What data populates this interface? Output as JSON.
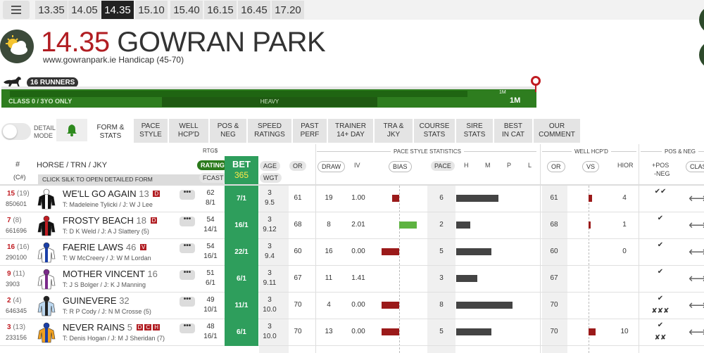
{
  "menu": {
    "icon": "hamburger-icon"
  },
  "times": [
    "13.35",
    "14.05",
    "14.35",
    "15.10",
    "15.40",
    "16.15",
    "16.45",
    "17.20"
  ],
  "active_time": "14.35",
  "race": {
    "time": "14.35",
    "course": "GOWRAN PARK",
    "name": "www.gowranpark.ie Handicap (45-70)",
    "weather_icon": "partly-cloudy-icon"
  },
  "runners_badge": "16 RUNNERS",
  "track": {
    "class_label": "CLASS 0 / 3YO ONLY",
    "going": "HEAVY",
    "distance": "1M",
    "marker": "1M"
  },
  "detail_mode": {
    "label_1": "DETAIL",
    "label_2": "MODE"
  },
  "tabs": [
    {
      "l1": "FORM &",
      "l2": "STATS"
    },
    {
      "l1": "PACE",
      "l2": "STYLE"
    },
    {
      "l1": "WELL",
      "l2": "HCP'D"
    },
    {
      "l1": "POS &",
      "l2": "NEG"
    },
    {
      "l1": "SPEED",
      "l2": "RATINGS"
    },
    {
      "l1": "PAST",
      "l2": "PERF"
    },
    {
      "l1": "TRAINER",
      "l2": "14+ DAY"
    },
    {
      "l1": "TRA &",
      "l2": "JKY"
    },
    {
      "l1": "COURSE",
      "l2": "STATS"
    },
    {
      "l1": "SIRE",
      "l2": "STATS"
    },
    {
      "l1": "BEST",
      "l2": "IN CAT"
    },
    {
      "l1": "OUR",
      "l2": "COMMENT"
    }
  ],
  "header": {
    "num": "#",
    "cnum": "(C#)",
    "horse": "HORSE / TRN / JKY",
    "silk_hint": "CLICK SILK TO OPEN DETAILED FORM",
    "rtgs": "RTG$",
    "rating": "RATING",
    "fcast": "FCAST",
    "bet": "BET",
    "bet_num": "365",
    "age": "AGE",
    "wgt": "WGT",
    "or": "OR",
    "pace_stats": "PACE STYLE STATISTICS",
    "draw": "DRAW",
    "iv": "IV",
    "bias": "BIAS",
    "pace": "PACE",
    "h": "H",
    "m": "M",
    "p": "P",
    "l": "L",
    "well_hcpd": "WELL HCP'D",
    "or2": "OR",
    "vs": "VS",
    "hior": "HIOR",
    "pos_neg": "POS & NEG",
    "pos_neg_col_1": "+POS",
    "pos_neg_col_2": "-NEG",
    "class": "CLASS"
  },
  "runners": [
    {
      "num": "15",
      "cnum": "(19)",
      "form": "850601",
      "name": "WE'LL GO AGAIN",
      "age_days": "13",
      "badges": [
        "D"
      ],
      "tj": "T: Madeleine Tylicki / J: W J Lee",
      "rating": "62",
      "fcast": "8/1",
      "bet": "7/1",
      "age": "3",
      "wgt": "9.5",
      "or": "61",
      "draw": "19",
      "iv": "1.00",
      "bias": -0.2,
      "pace": "6",
      "pace_bar": 0.6,
      "or2": "61",
      "vs": 0.1,
      "hior": "4",
      "pos": "✔✔",
      "neg": ""
    },
    {
      "num": "7",
      "cnum": "(8)",
      "form": "661696",
      "name": "FROSTY BEACH",
      "age_days": "18",
      "badges": [
        "D"
      ],
      "tj": "T: D K Weld / J: A J Slattery (5)",
      "rating": "54",
      "fcast": "14/1",
      "bet": "16/1",
      "age": "3",
      "wgt": "9.12",
      "or": "68",
      "draw": "8",
      "iv": "2.01",
      "bias": 0.5,
      "pace": "2",
      "pace_bar": 0.2,
      "or2": "68",
      "vs": 0.05,
      "hior": "1",
      "pos": "✔",
      "neg": ""
    },
    {
      "num": "16",
      "cnum": "(16)",
      "form": "290100",
      "name": "FAERIE LAWS",
      "age_days": "46",
      "badges": [
        "V"
      ],
      "tj": "T: W McCreery / J: W M Lordan",
      "rating": "54",
      "fcast": "16/1",
      "bet": "22/1",
      "age": "3",
      "wgt": "9.4",
      "or": "60",
      "draw": "16",
      "iv": "0.00",
      "bias": -0.5,
      "pace": "5",
      "pace_bar": 0.5,
      "or2": "60",
      "vs": 0,
      "hior": "0",
      "pos": "✔",
      "neg": ""
    },
    {
      "num": "9",
      "cnum": "(11)",
      "form": "3903",
      "name": "MOTHER VINCENT",
      "age_days": "16",
      "badges": [],
      "tj": "T: J S Bolger / J: K J Manning",
      "rating": "51",
      "fcast": "6/1",
      "bet": "6/1",
      "age": "3",
      "wgt": "9.11",
      "or": "67",
      "draw": "11",
      "iv": "1.41",
      "bias": 0,
      "pace": "3",
      "pace_bar": 0.3,
      "or2": "67",
      "vs": 0,
      "hior": "",
      "pos": "✔",
      "neg": ""
    },
    {
      "num": "2",
      "cnum": "(4)",
      "form": "646345",
      "name": "GUINEVERE",
      "age_days": "32",
      "badges": [],
      "tj": "T: R P Cody / J: N M Crosse (5)",
      "rating": "49",
      "fcast": "10/1",
      "bet": "11/1",
      "age": "3",
      "wgt": "10.0",
      "or": "70",
      "draw": "4",
      "iv": "0.00",
      "bias": -0.5,
      "pace": "8",
      "pace_bar": 0.8,
      "or2": "70",
      "vs": 0,
      "hior": "",
      "pos": "✔",
      "neg": "✘✘✘"
    },
    {
      "num": "3",
      "cnum": "(13)",
      "form": "233156",
      "name": "NEVER RAINS",
      "age_days": "5",
      "badges": [
        "D",
        "C",
        "H"
      ],
      "tj": "T: Denis Hogan / J: M J Sheridan (7)",
      "rating": "48",
      "fcast": "16/1",
      "bet": "6/1",
      "age": "3",
      "wgt": "10.0",
      "or": "70",
      "draw": "13",
      "iv": "0.00",
      "bias": -0.5,
      "pace": "5",
      "pace_bar": 0.5,
      "or2": "70",
      "vs": 0.2,
      "hior": "10",
      "pos": "✔",
      "neg": "✘✘"
    }
  ],
  "colors": {
    "bet": "#2e9e5c",
    "accent_red": "#b11d22",
    "track_green": "#2e7d1f",
    "pace_bar": "#444444",
    "bias_pos": "#5db340",
    "bias_neg": "#9b1a1a"
  }
}
